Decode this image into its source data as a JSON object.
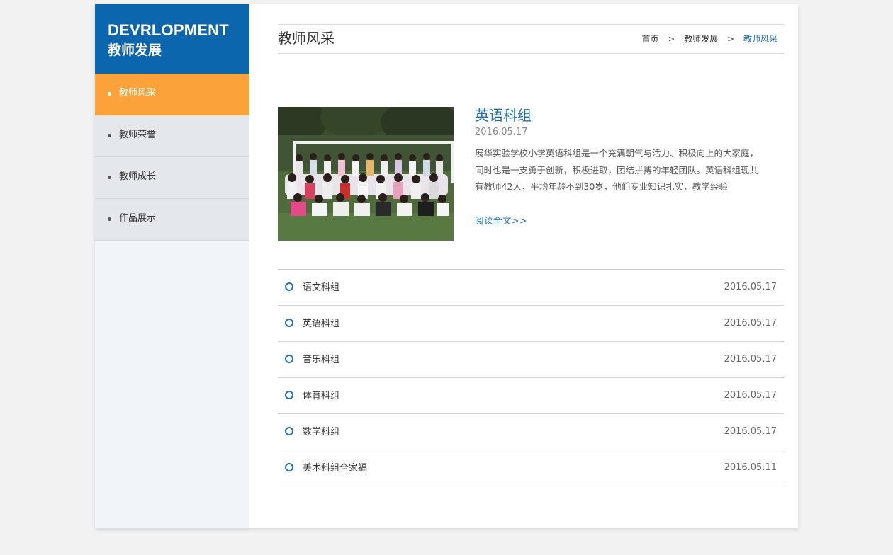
{
  "brand": {
    "title_en": "DEVRLOPMENT",
    "title_cn": "教师发展"
  },
  "sidebar": {
    "items": [
      {
        "label": "教师风采"
      },
      {
        "label": "教师荣誉"
      },
      {
        "label": "教师成长"
      },
      {
        "label": "作品展示"
      }
    ]
  },
  "header": {
    "title": "教师风采",
    "breadcrumb": {
      "home": "首页",
      "parent": "教师发展",
      "current": "教师风采",
      "separator": ">"
    }
  },
  "featured": {
    "title": "英语科组",
    "date": "2016.05.17",
    "description": "展华实验学校小学英语科组是一个充满朝气与活力、积极向上的大家庭，同时也是一支勇于创新，积极进取，团结拼搏的年轻团队。英语科组现共有教师42人，平均年龄不到30岁，他们专业知识扎实，教学经验",
    "read_more": "阅读全文>>"
  },
  "news": [
    {
      "title": "语文科组",
      "date": "2016.05.17"
    },
    {
      "title": "英语科组",
      "date": "2016.05.17"
    },
    {
      "title": "音乐科组",
      "date": "2016.05.17"
    },
    {
      "title": "体育科组",
      "date": "2016.05.17"
    },
    {
      "title": "数学科组",
      "date": "2016.05.17"
    },
    {
      "title": "美术科组全家福",
      "date": "2016.05.11"
    }
  ],
  "colors": {
    "primary": "#0c66ad",
    "accent": "#fba33a",
    "link": "#1f6fb2"
  }
}
